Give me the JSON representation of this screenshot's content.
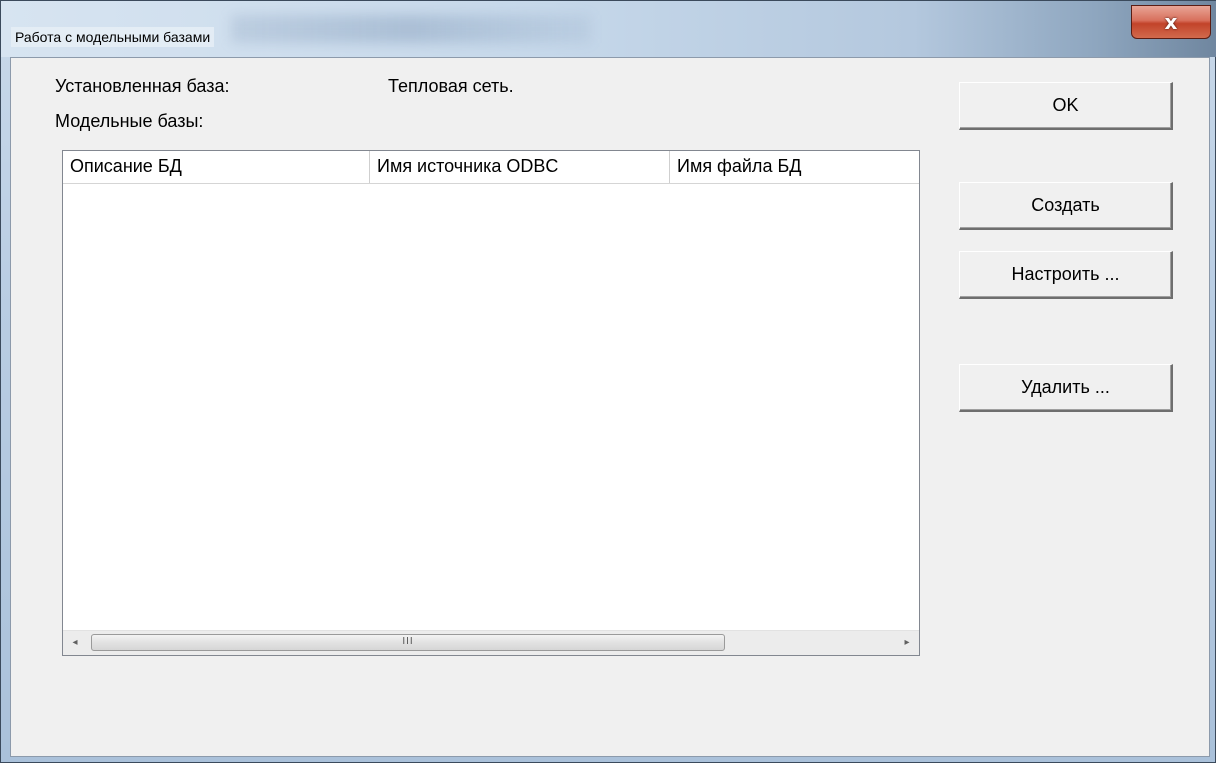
{
  "window": {
    "title": "Работа с модельными базами",
    "close_symbol": "x"
  },
  "installed": {
    "label": "Установленная база:",
    "value": "Тепловая сеть."
  },
  "model_bases_label": "Модельные базы:",
  "table": {
    "columns": [
      "Описание БД",
      "Имя источника ODBC",
      "Имя файла БД"
    ],
    "rows": []
  },
  "scrollbar": {
    "left_arrow": "◂",
    "right_arrow": "▸",
    "grip": "III"
  },
  "buttons": {
    "ok": "OK",
    "create": "Создать",
    "configure": "Настроить ...",
    "delete": "Удалить ..."
  }
}
